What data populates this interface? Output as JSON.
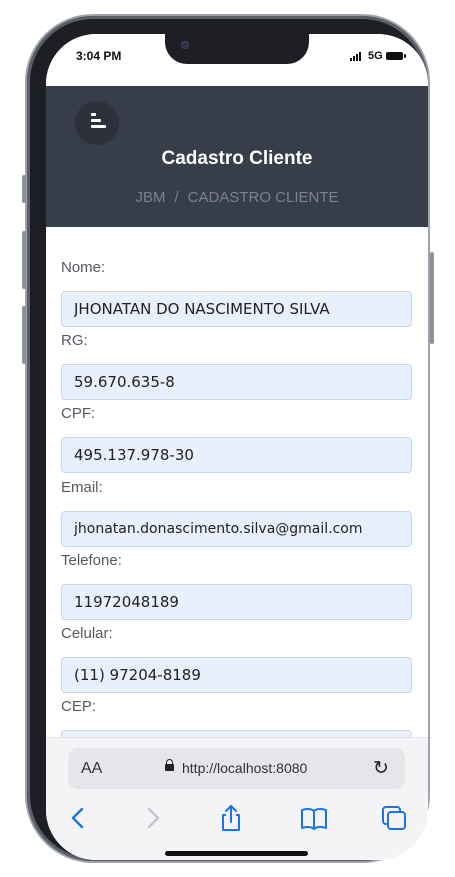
{
  "status": {
    "time": "3:04 PM",
    "network": "5G"
  },
  "header": {
    "title": "Cadastro Cliente",
    "breadcrumb": {
      "root": "JBM",
      "separator": "/",
      "current": "CADASTRO CLIENTE"
    }
  },
  "form": {
    "fields": [
      {
        "label": "Nome:",
        "value": "JHONATAN DO NASCIMENTO SILVA"
      },
      {
        "label": "RG:",
        "value": "59.670.635-8"
      },
      {
        "label": "CPF:",
        "value": "495.137.978-30"
      },
      {
        "label": "Email:",
        "value": "jhonatan.donascimento.silva@gmail.com"
      },
      {
        "label": "Telefone:",
        "value": "11972048189"
      },
      {
        "label": "Celular:",
        "value": "(11) 97204-8189"
      },
      {
        "label": "CEP:",
        "value": ""
      }
    ]
  },
  "browser": {
    "text_size_label": "AA",
    "url": "http://localhost:8080",
    "icons": [
      "lock-icon",
      "reload-icon",
      "back-icon",
      "forward-icon",
      "share-icon",
      "bookmarks-icon",
      "tabs-icon"
    ]
  },
  "colors": {
    "header_bg": "#383d4a",
    "input_bg": "#e8effd",
    "toolbar_accent": "#1a73e8"
  }
}
